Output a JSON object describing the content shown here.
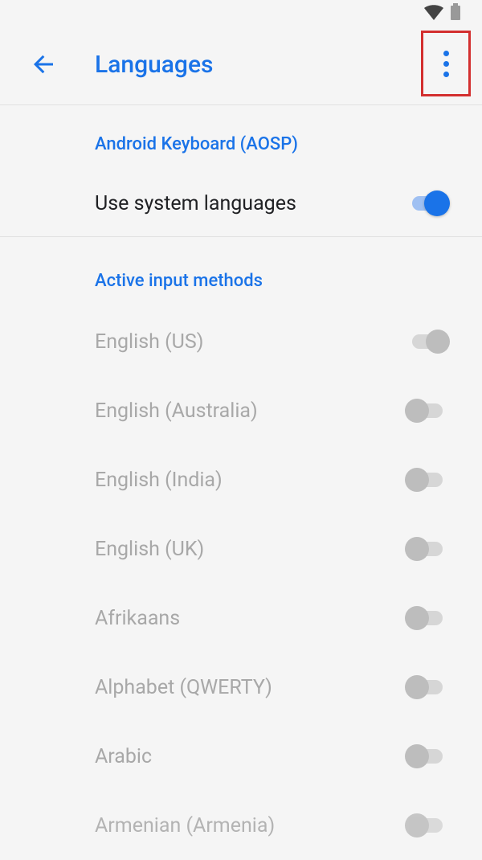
{
  "appbar": {
    "title": "Languages"
  },
  "keyboard": {
    "section_title": "Android Keyboard (AOSP)",
    "system_lang_label": "Use system languages"
  },
  "active_methods": {
    "section_title": "Active input methods",
    "items": [
      {
        "label": "English (US)",
        "on": true
      },
      {
        "label": "English (Australia)",
        "on": false
      },
      {
        "label": "English (India)",
        "on": false
      },
      {
        "label": "English (UK)",
        "on": false
      },
      {
        "label": "Afrikaans",
        "on": false
      },
      {
        "label": "Alphabet (QWERTY)",
        "on": false
      },
      {
        "label": "Arabic",
        "on": false
      },
      {
        "label": "Armenian (Armenia)",
        "on": false
      }
    ]
  }
}
